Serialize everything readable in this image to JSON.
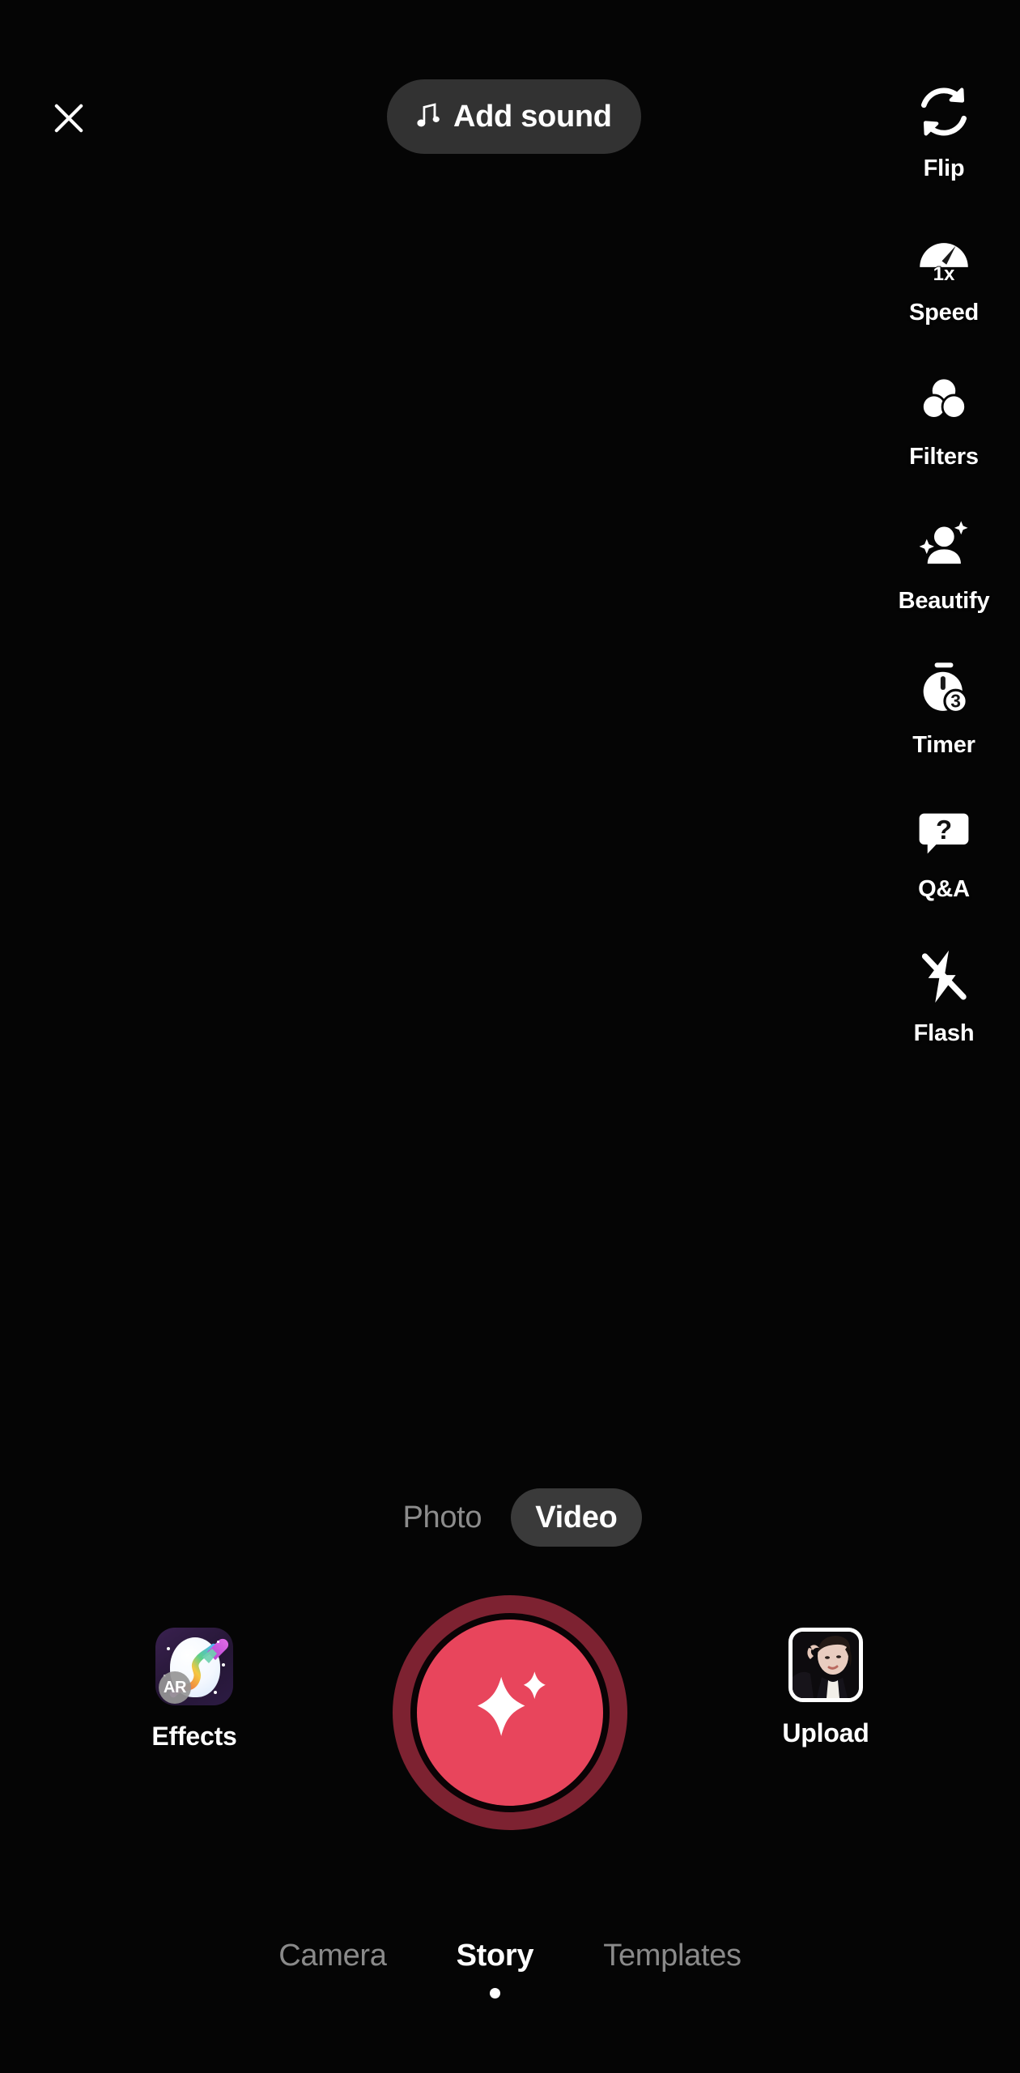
{
  "app": {
    "name": "TikTok Camera",
    "background_color": "#050505",
    "accent_color": "#e8455c",
    "ring_color": "#7d2231"
  },
  "top_bar": {
    "close_icon": "close-icon",
    "sound_button": {
      "label": "Add sound",
      "icon": "music-note-icon",
      "background_color": "#323232"
    }
  },
  "side_rail": {
    "items": [
      {
        "label": "Flip",
        "icon": "flip-camera-icon"
      },
      {
        "label": "Speed",
        "icon": "speedometer-icon",
        "badge": "1x"
      },
      {
        "label": "Filters",
        "icon": "filters-icon"
      },
      {
        "label": "Beautify",
        "icon": "beautify-icon"
      },
      {
        "label": "Timer",
        "icon": "timer-icon",
        "badge": "3"
      },
      {
        "label": "Q&A",
        "icon": "question-bubble-icon",
        "badge": "?"
      },
      {
        "label": "Flash",
        "icon": "flash-off-icon"
      }
    ]
  },
  "mode_toggle": {
    "options": [
      {
        "label": "Photo",
        "selected": false
      },
      {
        "label": "Video",
        "selected": true
      }
    ],
    "selected": "Video"
  },
  "capture_row": {
    "effects": {
      "label": "Effects",
      "icon": "ar-effects-icon",
      "badge": "AR"
    },
    "record": {
      "label": "",
      "icon": "sparkle-icon",
      "fill_color": "#e8455c",
      "ring_color": "#7d2231"
    },
    "upload": {
      "label": "Upload",
      "icon": "gallery-thumbnail-icon"
    }
  },
  "bottom_tabs": {
    "items": [
      {
        "label": "Camera",
        "active": false
      },
      {
        "label": "Story",
        "active": true
      },
      {
        "label": "Templates",
        "active": false
      }
    ],
    "selected": "Story"
  }
}
